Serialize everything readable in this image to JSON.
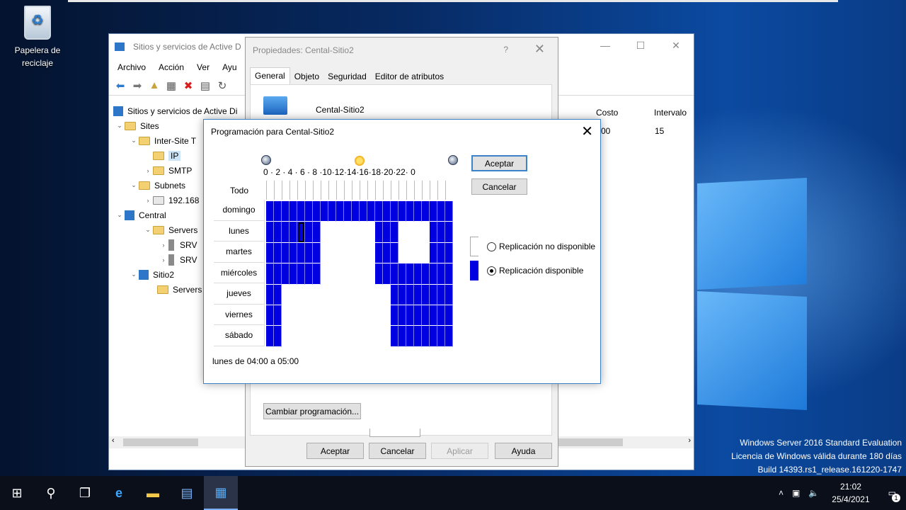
{
  "desktop": {
    "recycle_bin_label": "Papelera de reciclaje",
    "watermark": [
      "Windows Server 2016 Standard Evaluation",
      "Licencia de Windows válida durante 180 días",
      "Build 14393.rs1_release.161220-1747"
    ]
  },
  "mmc": {
    "title": "Sitios y servicios de Active D",
    "menu": [
      "Archivo",
      "Acción",
      "Ver",
      "Ayu"
    ],
    "tree": {
      "root": "Sitios y servicios de Active Di",
      "sites": "Sites",
      "inter_site": "Inter-Site T",
      "ip": "IP",
      "smtp": "SMTP",
      "subnets": "Subnets",
      "subnet_item": "192.168",
      "central": "Central",
      "servers1": "Servers",
      "srv_a": "SRV",
      "srv_b": "SRV",
      "sitio2": "Sitio2",
      "servers2": "Servers"
    },
    "columns": {
      "costo": "Costo",
      "intervalo": "Intervalo"
    },
    "row": {
      "costo": "00",
      "intervalo": "15"
    }
  },
  "props": {
    "title": "Propiedades: Cental-Sitio2",
    "help": "?",
    "tabs": [
      "General",
      "Objeto",
      "Seguridad",
      "Editor de atributos"
    ],
    "site_name": "Cental-Sitio2",
    "change_schedule": "Cambiar programación...",
    "buttons": {
      "ok": "Aceptar",
      "cancel": "Cancelar",
      "apply": "Aplicar",
      "help": "Ayuda"
    }
  },
  "schedule": {
    "title": "Programación para Cental-Sitio2",
    "hours_label": "0 · 2 · 4 · 6 · 8 ·10·12·14·16·18·20·22· 0",
    "all_label": "Todo",
    "days": [
      "domingo",
      "lunes",
      "martes",
      "miércoles",
      "jueves",
      "viernes",
      "sábado"
    ],
    "grid": [
      [
        1,
        1,
        1,
        1,
        1,
        1,
        1,
        1,
        1,
        1,
        1,
        1,
        1,
        1,
        1,
        1,
        1,
        1,
        1,
        1,
        1,
        1,
        1,
        1
      ],
      [
        1,
        1,
        1,
        1,
        1,
        1,
        1,
        0,
        0,
        0,
        0,
        0,
        0,
        0,
        1,
        1,
        1,
        0,
        0,
        0,
        0,
        1,
        1,
        1
      ],
      [
        1,
        1,
        1,
        1,
        1,
        1,
        1,
        0,
        0,
        0,
        0,
        0,
        0,
        0,
        1,
        1,
        1,
        0,
        0,
        0,
        0,
        1,
        1,
        1
      ],
      [
        1,
        1,
        1,
        1,
        1,
        1,
        1,
        0,
        0,
        0,
        0,
        0,
        0,
        0,
        1,
        1,
        1,
        1,
        1,
        1,
        1,
        1,
        1,
        1
      ],
      [
        1,
        1,
        0,
        0,
        0,
        0,
        0,
        0,
        0,
        0,
        0,
        0,
        0,
        0,
        0,
        0,
        1,
        1,
        1,
        1,
        1,
        1,
        1,
        1
      ],
      [
        1,
        1,
        0,
        0,
        0,
        0,
        0,
        0,
        0,
        0,
        0,
        0,
        0,
        0,
        0,
        0,
        1,
        1,
        1,
        1,
        1,
        1,
        1,
        1
      ],
      [
        1,
        1,
        0,
        0,
        0,
        0,
        0,
        0,
        0,
        0,
        0,
        0,
        0,
        0,
        0,
        0,
        1,
        1,
        1,
        1,
        1,
        1,
        1,
        1
      ]
    ],
    "selected_cell": {
      "day": 1,
      "hour": 4
    },
    "status": "lunes de 04:00 a 05:00",
    "ok": "Aceptar",
    "cancel": "Cancelar",
    "legend_unavailable": "Replicación no disponible",
    "legend_available": "Replicación disponible",
    "selected_option": "available"
  },
  "taskbar": {
    "time": "21:02",
    "date": "25/4/2021",
    "notifications": "1"
  }
}
